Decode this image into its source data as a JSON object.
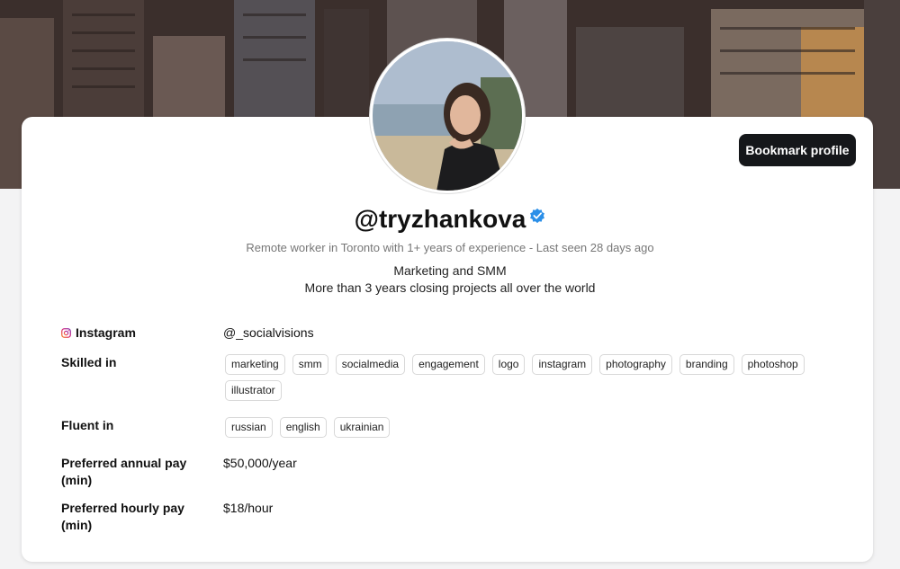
{
  "profile": {
    "handle": "@tryzhankova",
    "subtitle": "Remote worker in Toronto with 1+ years of experience - Last seen 28 days ago",
    "bio_line1": "Marketing and SMM",
    "bio_line2": "More than 3 years closing projects all over the world",
    "verified_icon": "verified-badge-icon",
    "verified_color": "#2b8fe8"
  },
  "actions": {
    "bookmark_label": "Bookmark profile"
  },
  "details": {
    "instagram_label": "Instagram",
    "instagram_value": "@_socialvisions",
    "skilled_label": "Skilled in",
    "skills": [
      "marketing",
      "smm",
      "socialmedia",
      "engagement",
      "logo",
      "instagram",
      "photography",
      "branding",
      "photoshop",
      "illustrator"
    ],
    "fluent_label": "Fluent in",
    "languages": [
      "russian",
      "english",
      "ukrainian"
    ],
    "annual_label_1": "Preferred annual pay",
    "annual_label_2": "(min)",
    "annual_value": "$50,000/year",
    "hourly_label_1": "Preferred hourly pay",
    "hourly_label_2": "(min)",
    "hourly_value": "$18/hour"
  },
  "colors": {
    "button_bg": "#15171a",
    "instagram_accent": "#d6249f"
  }
}
